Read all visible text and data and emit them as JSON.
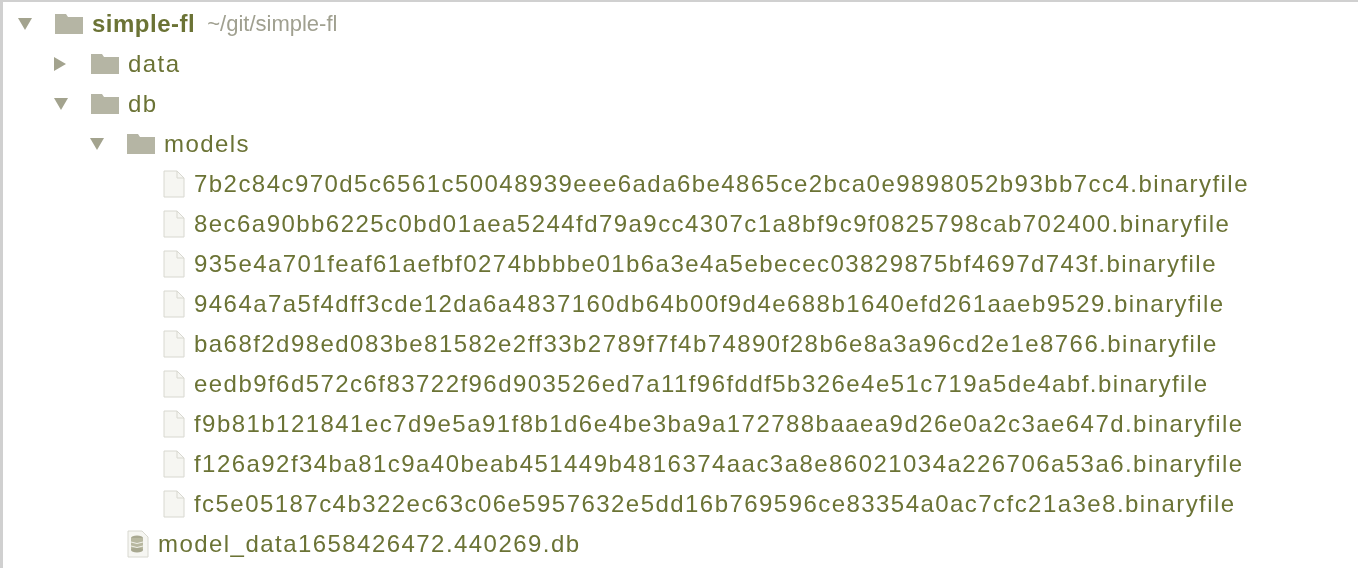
{
  "tree": [
    {
      "kind": "project",
      "name": "simple-fl",
      "path": "~/git/simple-fl",
      "expanded": true,
      "children": [
        {
          "kind": "folder",
          "name": "data",
          "expanded": false
        },
        {
          "kind": "folder",
          "name": "db",
          "expanded": true,
          "children": [
            {
              "kind": "folder",
              "name": "models",
              "expanded": true,
              "children": [
                {
                  "kind": "file",
                  "name": "7b2c84c970d5c6561c50048939eee6ada6be4865ce2bca0e9898052b93bb7cc4.binaryfile"
                },
                {
                  "kind": "file",
                  "name": "8ec6a90bb6225c0bd01aea5244fd79a9cc4307c1a8bf9c9f0825798cab702400.binaryfile"
                },
                {
                  "kind": "file",
                  "name": "935e4a701feaf61aefbf0274bbbbe01b6a3e4a5ebecec03829875bf4697d743f.binaryfile"
                },
                {
                  "kind": "file",
                  "name": "9464a7a5f4dff3cde12da6a4837160db64b00f9d4e688b1640efd261aaeb9529.binaryfile"
                },
                {
                  "kind": "file",
                  "name": "ba68f2d98ed083be81582e2ff33b2789f7f4b74890f28b6e8a3a96cd2e1e8766.binaryfile"
                },
                {
                  "kind": "file",
                  "name": "eedb9f6d572c6f83722f96d903526ed7a11f96fddf5b326e4e51c719a5de4abf.binaryfile"
                },
                {
                  "kind": "file",
                  "name": "f9b81b121841ec7d9e5a91f8b1d6e4be3ba9a172788baaea9d26e0a2c3ae647d.binaryfile"
                },
                {
                  "kind": "file",
                  "name": "f126a92f34ba81c9a40beab451449b4816374aac3a8e86021034a226706a53a6.binaryfile"
                },
                {
                  "kind": "file",
                  "name": "fc5e05187c4b322ec63c06e5957632e5dd16b769596ce83354a0ac7cfc21a3e8.binaryfile"
                }
              ]
            },
            {
              "kind": "database",
              "name": "model_data1658426472.440269.db"
            }
          ]
        }
      ]
    }
  ]
}
